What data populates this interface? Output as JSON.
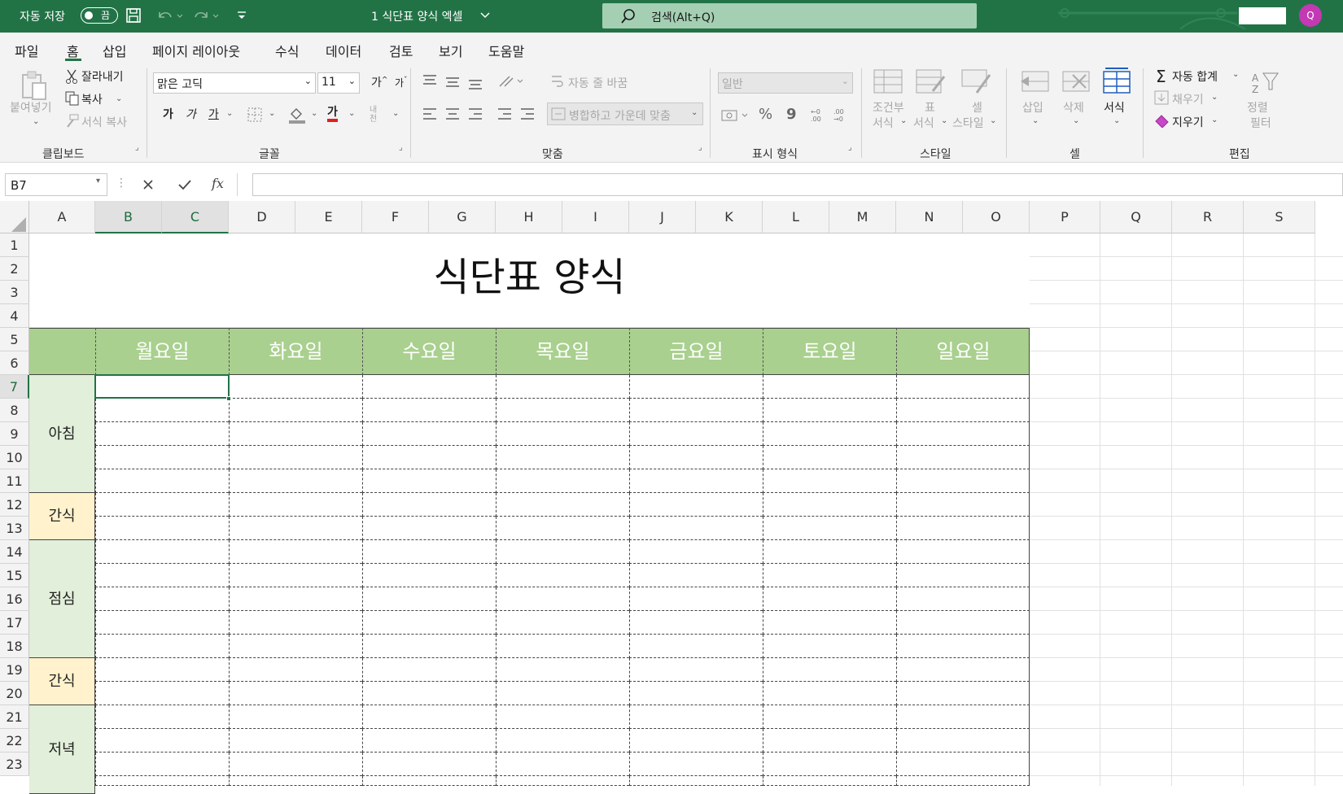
{
  "titlebar": {
    "autosave_label": "자동 저장",
    "autosave_state": "끔",
    "file_title": "1 식단표 양식 엑셀",
    "search_placeholder": "검색(Alt+Q)",
    "avatar_letter": "Q"
  },
  "menu": {
    "tabs": [
      "파일",
      "홈",
      "삽입",
      "페이지 레이아웃",
      "수식",
      "데이터",
      "검토",
      "보기",
      "도움말"
    ],
    "active": "홈"
  },
  "ribbon": {
    "clipboard": {
      "paste": "붙여넣기",
      "cut": "잘라내기",
      "copy": "복사",
      "format_painter": "서식 복사",
      "label": "클립보드"
    },
    "font": {
      "name": "맑은 고딕",
      "size": "11",
      "bold": "가",
      "italic": "가",
      "underline": "가",
      "font_color_glyph": "가",
      "phonetic": "내천",
      "label": "글꼴"
    },
    "alignment": {
      "wrap_text": "자동 줄 바꿈",
      "merge_center": "병합하고 가운데 맞춤",
      "label": "맞춤"
    },
    "number": {
      "format": "일반",
      "percent": "%",
      "comma": "9",
      "label": "표시 형식"
    },
    "styles": {
      "conditional_1": "조건부",
      "conditional_2": "서식",
      "table_1": "표",
      "table_2": "서식",
      "cell_style_1": "셀",
      "cell_style_2": "스타일",
      "label": "스타일"
    },
    "cells": {
      "insert": "삽입",
      "delete": "삭제",
      "format": "서식",
      "label": "셀"
    },
    "editing": {
      "autosum": "자동 합계",
      "fill": "채우기",
      "clear": "지우기",
      "sort_1": "정렬",
      "sort_2": "필터",
      "label": "편집"
    },
    "colors": {
      "title_green": "#217346",
      "header_green": "#a9d08e",
      "meal_green": "#e2efda",
      "snack_yellow": "#fff2cc"
    }
  },
  "formula_bar": {
    "name_box": "B7",
    "fx": "fx",
    "value": ""
  },
  "sheet": {
    "columns": [
      "A",
      "B",
      "C",
      "D",
      "E",
      "F",
      "G",
      "H",
      "I",
      "J",
      "K",
      "L",
      "M",
      "N",
      "O",
      "P",
      "Q",
      "R",
      "S"
    ],
    "rows": [
      "1",
      "2",
      "3",
      "4",
      "5",
      "6",
      "7",
      "8",
      "9",
      "10",
      "11",
      "12",
      "13",
      "14",
      "15",
      "16",
      "17",
      "18",
      "19",
      "20",
      "21",
      "22",
      "23"
    ],
    "title": "식단표 양식",
    "days": [
      "월요일",
      "화요일",
      "수요일",
      "목요일",
      "금요일",
      "토요일",
      "일요일"
    ],
    "meals": [
      "아침",
      "간식",
      "점심",
      "간식",
      "저녁"
    ]
  }
}
